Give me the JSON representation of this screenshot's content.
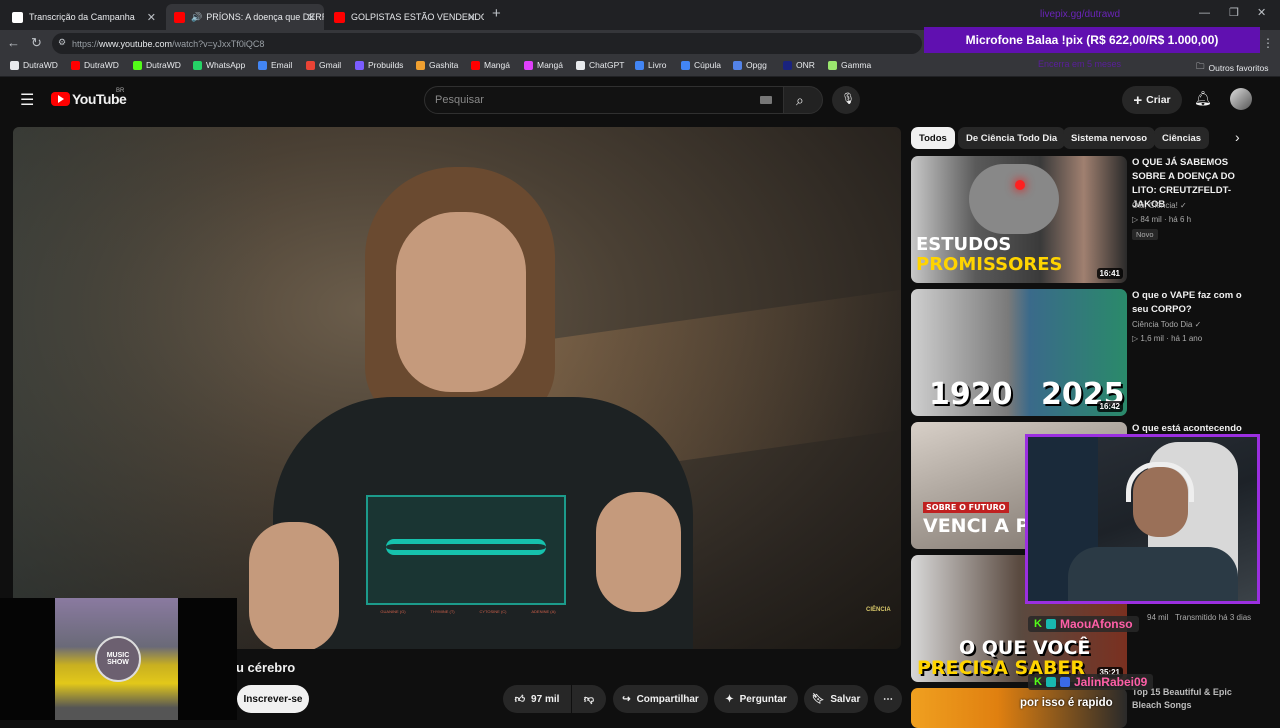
{
  "tabs": [
    {
      "title": "Transcrição da Campanha",
      "color": "#ffffff"
    },
    {
      "title": "PRÍONS: A doença que DERR",
      "color": "#ff0000"
    },
    {
      "title": "GOLPISTAS ESTÃO VENDENDO FI",
      "color": "#ff0000"
    }
  ],
  "address": {
    "prefix": "https://",
    "domain": "www.youtube.com",
    "path": "/watch?v=yJxxTf0iQC8"
  },
  "bookmarks": [
    {
      "label": "DutraWD",
      "color": "#e8eaed"
    },
    {
      "label": "DutraWD",
      "color": "#ff0000"
    },
    {
      "label": "DutraWD",
      "color": "#53fc18"
    },
    {
      "label": "WhatsApp",
      "color": "#25d366"
    },
    {
      "label": "Email",
      "color": "#4285f4"
    },
    {
      "label": "Gmail",
      "color": "#ea4335"
    },
    {
      "label": "Probuilds",
      "color": "#7b5cff"
    },
    {
      "label": "Gashita",
      "color": "#f0a030"
    },
    {
      "label": "Mangá",
      "color": "#ff0000"
    },
    {
      "label": "Mangá",
      "color": "#e040fb"
    },
    {
      "label": "ChatGPT",
      "color": "#e8eaed"
    },
    {
      "label": "Livro",
      "color": "#4285f4"
    },
    {
      "label": "Cúpula",
      "color": "#4285f4"
    },
    {
      "label": "Opgg",
      "color": "#5383e8"
    },
    {
      "label": "ONR",
      "color": "#1a237e"
    },
    {
      "label": "Gamma",
      "color": "#9ae66e"
    }
  ],
  "other_favorites": "Outros favoritos",
  "youtube": {
    "logo": "YouTube",
    "region": "BR",
    "search_placeholder": "Pesquisar",
    "create_label": "Criar"
  },
  "video": {
    "title_partial": "u cérebro",
    "subscribe": "Inscrever-se",
    "likes": "97 mil",
    "share": "Compartilhar",
    "ask": "Perguntar",
    "save": "Salvar",
    "watermark": "CIÊNCIA",
    "shirt_labels": [
      "GUANINE (G)",
      "THYMINE (T)",
      "CYTOSINE (C)",
      "ADENINE (A)"
    ]
  },
  "chips": [
    {
      "label": "Todos",
      "active": true
    },
    {
      "label": "De Ciência Todo Dia",
      "active": false
    },
    {
      "label": "Sistema nervoso",
      "active": false
    },
    {
      "label": "Ciências",
      "active": false
    }
  ],
  "recommendations": [
    {
      "title": "O QUE JÁ SABEMOS SOBRE A DOENÇA DO LITO: CREUTZFELDT-JAKOB",
      "channel": "Olá, Ciência!",
      "meta": "84 mil · há 6 h",
      "badge": "Novo",
      "duration": "16:41",
      "thumb_lines": [
        "ESTUDOS",
        "PROMISSORES"
      ]
    },
    {
      "title": "O que o VAPE faz com o seu CORPO?",
      "channel": "Ciência Todo Dia",
      "meta": "1,6 mil · há 1 ano",
      "duration": "16:42",
      "thumb_lines": [
        "1920",
        "2025"
      ]
    },
    {
      "title": "O que está acontecendo",
      "thumb_lines": [
        "SOBRE O FUTURO",
        "VENCI A PRIME"
      ]
    },
    {
      "meta_partial": "94 mil",
      "meta2": "Transmitido há 3 dias",
      "duration": "35:21",
      "thumb_lines": [
        "O QUE VOCÊ",
        "PRECISA SABER"
      ]
    },
    {
      "title": "Top 15 Beautiful & Epic Bleach Songs",
      "thumb_lines": []
    }
  ],
  "stream_overlay": {
    "livepix_url": "livepix.gg/dutrawd",
    "goal_text": "Microfone Balaa !pix (R$ 622,00/R$ 1.000,00)",
    "goal_sub": "Encerra em 5 meses",
    "chat": [
      {
        "user": "MaouAfonso",
        "color": "#ff5fa8"
      },
      {
        "user": "JalinRabei09",
        "color": "#ff5fa8"
      }
    ],
    "chat_message": "por isso é rapido",
    "music_logo": "MUSIC SHOW"
  }
}
